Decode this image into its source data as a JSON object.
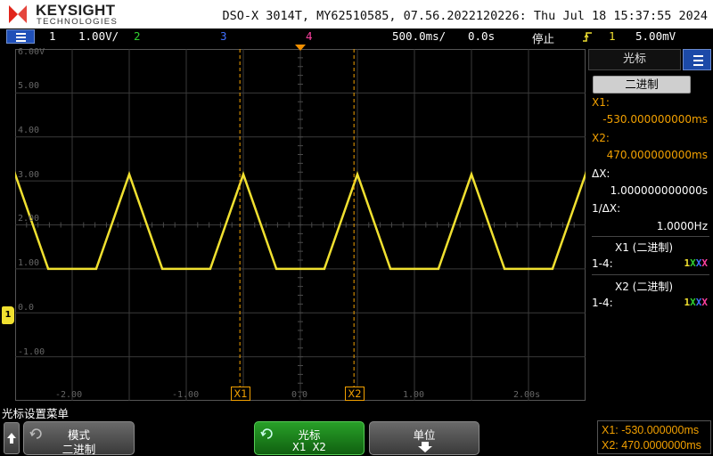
{
  "header": {
    "brand": "KEYSIGHT",
    "brand_sub": "TECHNOLOGIES",
    "model_info": "DSO-X 3014T, MY62510585, 07.56.2022120226: Thu Jul 18 15:37:55 2024"
  },
  "statusbar": {
    "ch1": "1",
    "ch1_scale": "1.00V/",
    "ch2": "2",
    "ch3": "3",
    "ch4": "4",
    "timebase": "500.0ms/",
    "delay": "0.0s",
    "run_state": "停止",
    "trigger_channel": "1",
    "trigger_level": "5.00mV"
  },
  "graticule": {
    "y_labels": [
      "6.00V",
      "5.00",
      "4.00",
      "3.00",
      "2.00",
      "1.00",
      "0.0",
      "-1.00"
    ],
    "x_labels": [
      "-2.00",
      "-1.00",
      "0.0",
      "1.00",
      "2.00s"
    ],
    "cursor_x1_label": "X1",
    "cursor_x2_label": "X2",
    "ground_marker": "1"
  },
  "colors": {
    "ch1": "#f0e030",
    "ch2": "#30d030",
    "ch3": "#4070ff",
    "ch4": "#ff40a0",
    "cursor": "#f2a000"
  },
  "waveform": {
    "type": "triangle-with-flat-bottom",
    "high_v": 3.15,
    "low_v": 1.0
  },
  "side_panel": {
    "title": "光标",
    "mode_button": "二进制",
    "x1_label": "X1:",
    "x1_value": "-530.000000000ms",
    "x2_label": "X2:",
    "x2_value": "470.000000000ms",
    "dx_label": "ΔX:",
    "dx_value": "1.000000000000s",
    "inv_dx_label": "1/ΔX:",
    "inv_dx_value": "1.0000Hz",
    "x1_binary_title": "X1 (二进制)",
    "x1_binary_range": "1-4:",
    "x1_binary_value": "1XXX",
    "x2_binary_title": "X2 (二进制)",
    "x2_binary_range": "1-4:",
    "x2_binary_value": "1XXX"
  },
  "softkeys": {
    "menu_title": "光标设置菜单",
    "mode_label": "模式",
    "mode_value": "二进制",
    "cursors_label": "光标",
    "cursors_value": "X1 X2",
    "units_label": "单位"
  },
  "cursor_readout": {
    "x1": "X1: -530.000000ms",
    "x2": "X2: 470.0000000ms"
  }
}
